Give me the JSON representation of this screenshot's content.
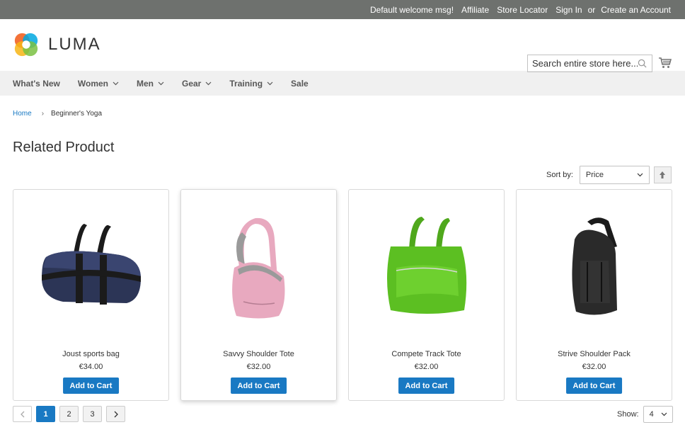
{
  "topbar": {
    "welcome": "Default welcome msg!",
    "affiliate": "Affiliate",
    "store_locator": "Store Locator",
    "sign_in": "Sign In",
    "or": "or",
    "create_account": "Create an Account"
  },
  "header": {
    "logo_text": "LUMA",
    "search_placeholder": "Search entire store here...",
    "cart_icon": "cart-icon"
  },
  "nav": {
    "items": [
      {
        "label": "What's New"
      },
      {
        "label": "Women"
      },
      {
        "label": "Men"
      },
      {
        "label": "Gear"
      },
      {
        "label": "Training"
      },
      {
        "label": "Sale"
      }
    ]
  },
  "breadcrumb": {
    "home": "Home",
    "current": "Beginner's Yoga"
  },
  "main": {
    "title": "Related Product",
    "sort_label": "Sort by:",
    "sort_value": "Price"
  },
  "products": [
    {
      "name": "Joust sports bag",
      "price": "€34.00",
      "button": "Add to Cart",
      "color": "#2c3556"
    },
    {
      "name": "Savvy Shoulder Tote",
      "price": "€32.00",
      "button": "Add to Cart",
      "color": "#e8a9bf"
    },
    {
      "name": "Compete Track Tote",
      "price": "€32.00",
      "button": "Add to Cart",
      "color": "#5cbf22"
    },
    {
      "name": "Strive Shoulder Pack",
      "price": "€32.00",
      "button": "Add to Cart",
      "color": "#2a2a2a"
    }
  ],
  "pager": {
    "pages": [
      "1",
      "2",
      "3"
    ],
    "current": "1"
  },
  "limiter": {
    "label": "Show:",
    "value": "4"
  },
  "colors": {
    "accent": "#1979c3",
    "topbar": "#6e716e",
    "nav_bg": "#f0f0f0"
  }
}
